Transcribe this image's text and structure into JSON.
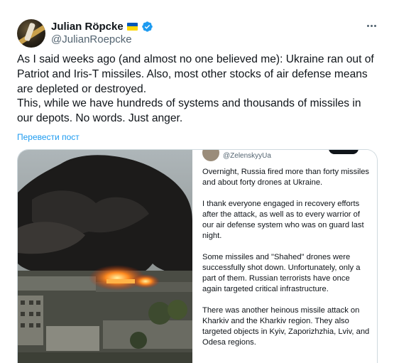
{
  "tweet": {
    "display_name": "Julian Röpcke",
    "handle": "@JulianRoepcke",
    "text_paragraphs": [
      "As I said weeks ago (and almost no one believed me): Ukraine ran out of Patriot and Iris-T missiles. Also, most other stocks of air defense means are depleted or destroyed.",
      "This, while we have hundreds of systems and thousands of missiles in our depots. No words. Just anger."
    ],
    "translate_label": "Перевести пост"
  },
  "media": {
    "embedded_post": {
      "handle": "@ZelenskyyUa",
      "paragraphs": [
        "Overnight, Russia fired more than forty missiles and about forty drones at Ukraine.",
        "I thank everyone engaged in recovery efforts after the attack, as well as to every warrior of our air defense system who was on guard last night.",
        "Some missiles and \"Shahed\" drones were successfully shot down. Unfortunately, only a part of them. Russian terrorists have once again targeted critical infrastructure.",
        "There was another heinous missile attack on Kharkiv and the Kharkiv region. They also targeted objects in Kyiv, Zaporizhzhia, Lviv, and Odesa regions."
      ]
    }
  },
  "colors": {
    "accent": "#1d9bf0",
    "text_primary": "#0f1419",
    "text_secondary": "#536471",
    "border": "#cfd9de"
  },
  "icons": {
    "verified": "verified-badge-icon",
    "flag": "ukraine-flag-icon",
    "more": "more-options-icon"
  }
}
